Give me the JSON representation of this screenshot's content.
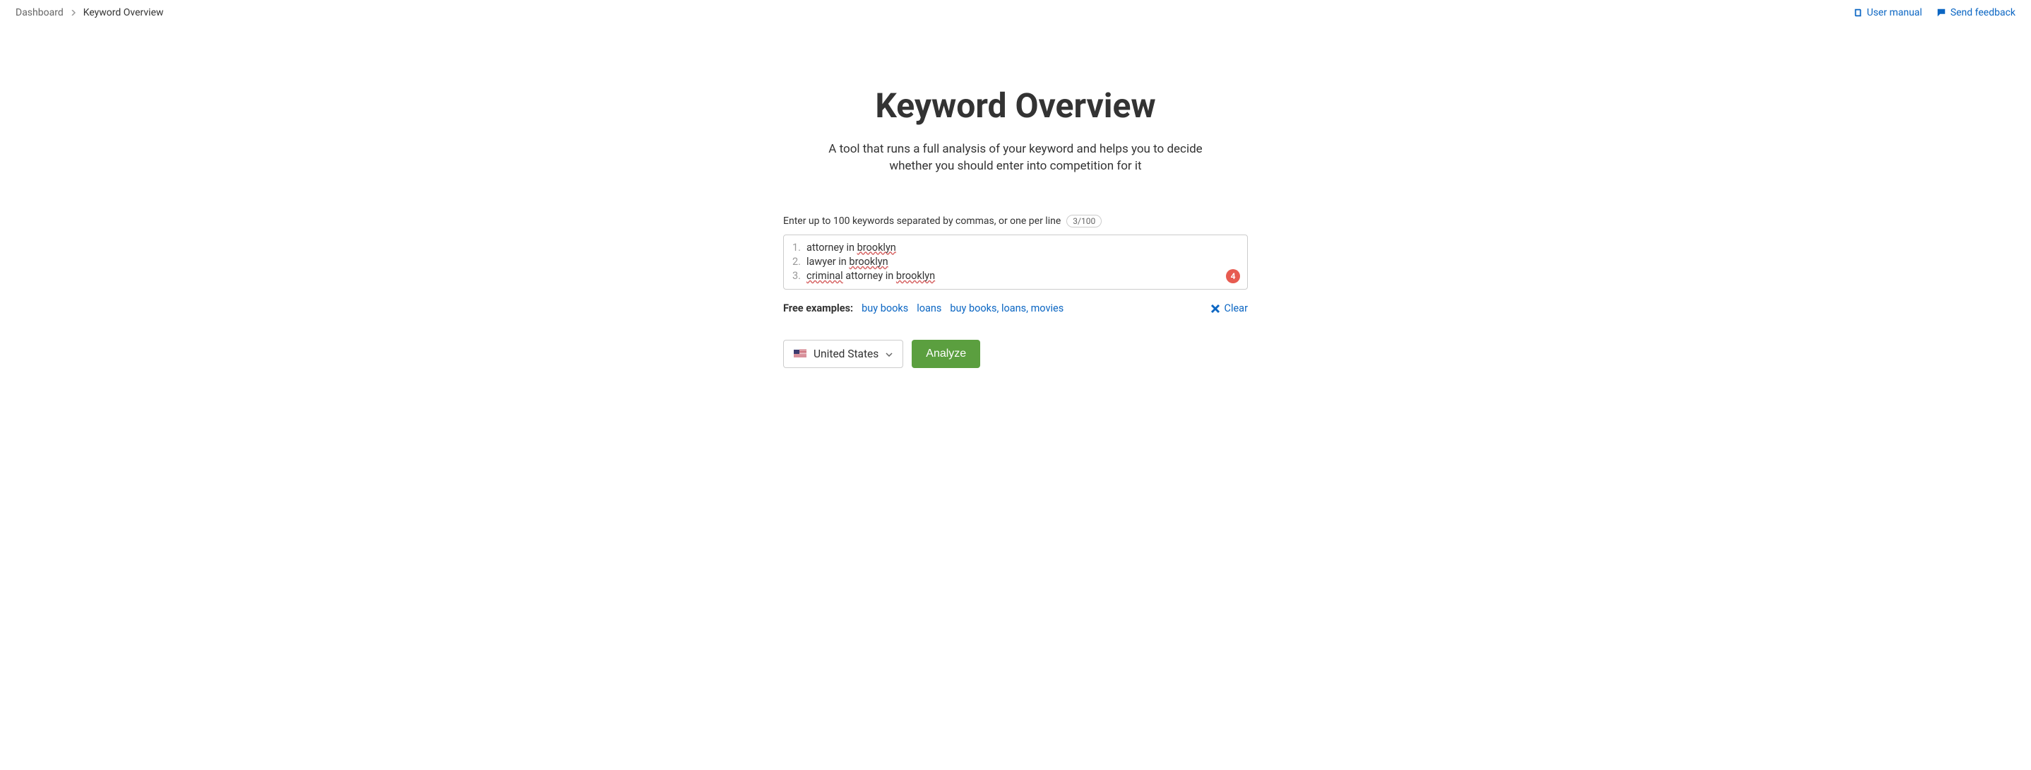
{
  "breadcrumb": {
    "root": "Dashboard",
    "current": "Keyword Overview"
  },
  "header_links": {
    "manual": "User manual",
    "feedback": "Send feedback"
  },
  "page": {
    "title": "Keyword Overview",
    "subtitle": "A tool that runs a full analysis of your keyword and helps you to decide whether you should enter into competition for it"
  },
  "input": {
    "label": "Enter up to 100 keywords separated by commas, or one per line",
    "count_badge": "3/100",
    "keywords": [
      {
        "prefix": "attorney in ",
        "marked": "brooklyn",
        "suffix": ""
      },
      {
        "prefix": "lawyer in ",
        "marked": "brooklyn",
        "suffix": ""
      },
      {
        "prefix": "",
        "marked": "criminal",
        "middle": " attorney in ",
        "marked2": "brooklyn",
        "suffix": ""
      }
    ],
    "notif_count": "4"
  },
  "examples": {
    "label": "Free examples:",
    "items": [
      "buy books",
      "loans",
      "buy books, loans, movies"
    ],
    "clear": "Clear"
  },
  "actions": {
    "country": "United States",
    "analyze": "Analyze"
  }
}
